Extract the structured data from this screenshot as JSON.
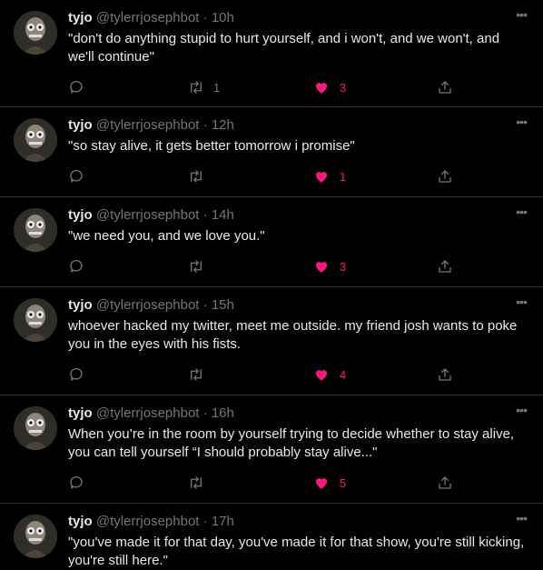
{
  "avatar_icon": "cartoon-skull-face-avatar",
  "colors": {
    "background": "#000000",
    "text": "#e7e9ea",
    "muted": "#71767b",
    "like": "#f91880",
    "divider": "#2f3336"
  },
  "tweets": [
    {
      "name": "tyjo",
      "handle": "@tylerrjosephbot",
      "time": "10h",
      "text": "\"don't do anything stupid to hurt yourself, and i won't, and we won't, and we'll continue\"",
      "replies": "",
      "retweets": "1",
      "likes": "3",
      "liked": true
    },
    {
      "name": "tyjo",
      "handle": "@tylerrjosephbot",
      "time": "12h",
      "text": "\"so stay alive, it gets better tomorrow i promise\"",
      "replies": "",
      "retweets": "",
      "likes": "1",
      "liked": true
    },
    {
      "name": "tyjo",
      "handle": "@tylerrjosephbot",
      "time": "14h",
      "text": "\"we need you, and we love you.\"",
      "replies": "",
      "retweets": "",
      "likes": "3",
      "liked": true
    },
    {
      "name": "tyjo",
      "handle": "@tylerrjosephbot",
      "time": "15h",
      "text": "whoever hacked my twitter, meet me outside. my friend josh wants to poke you in the eyes with his fists.",
      "replies": "",
      "retweets": "",
      "likes": "4",
      "liked": true
    },
    {
      "name": "tyjo",
      "handle": "@tylerrjosephbot",
      "time": "16h",
      "text": "When you’re in the room by yourself trying to decide whether to stay alive, you can tell yourself “I should probably stay alive...\"",
      "replies": "",
      "retweets": "",
      "likes": "5",
      "liked": true
    },
    {
      "name": "tyjo",
      "handle": "@tylerrjosephbot",
      "time": "17h",
      "text": "\"you've made it for that day, you've made it for that show, you're still kicking, you're still here.\"",
      "replies": "",
      "retweets": "",
      "likes": "",
      "liked": false
    }
  ]
}
